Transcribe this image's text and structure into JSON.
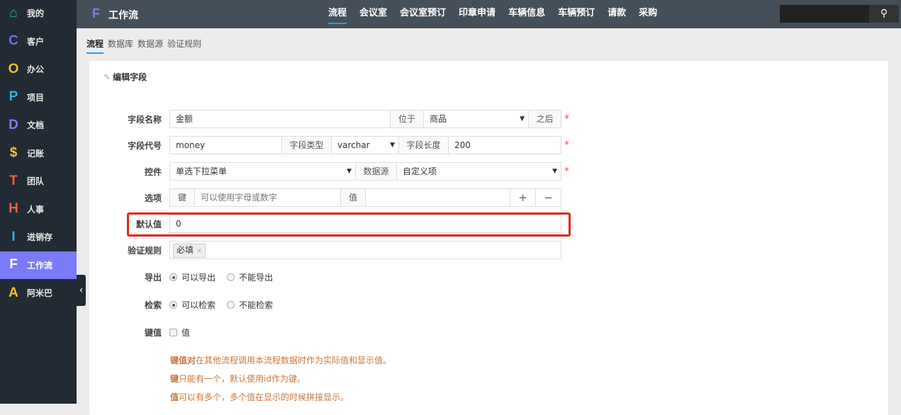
{
  "sidebar": {
    "items": [
      {
        "icon": "home-icon",
        "glyph": "⌂",
        "label": "我的",
        "color": "#29b6e0"
      },
      {
        "icon": "c-letter-icon",
        "glyph": "C",
        "label": "客户",
        "color": "#6b6ff0"
      },
      {
        "icon": "o-letter-icon",
        "glyph": "O",
        "label": "办公",
        "color": "#f2c037"
      },
      {
        "icon": "p-letter-icon",
        "glyph": "P",
        "label": "项目",
        "color": "#29b6e0"
      },
      {
        "icon": "d-letter-icon",
        "glyph": "D",
        "label": "文档",
        "color": "#7b7ff5"
      },
      {
        "icon": "dollar-icon",
        "glyph": "$",
        "label": "记账",
        "color": "#f2c037"
      },
      {
        "icon": "t-letter-icon",
        "glyph": "T",
        "label": "团队",
        "color": "#e8653a"
      },
      {
        "icon": "h-letter-icon",
        "glyph": "H",
        "label": "人事",
        "color": "#e8653a"
      },
      {
        "icon": "i-letter-icon",
        "glyph": "I",
        "label": "进销存",
        "color": "#29b6e0"
      },
      {
        "icon": "f-letter-icon",
        "glyph": "F",
        "label": "工作流",
        "color": "#ffffff"
      },
      {
        "icon": "a-letter-icon",
        "glyph": "A",
        "label": "阿米巴",
        "color": "#f2c037"
      }
    ],
    "active_index": 9
  },
  "header": {
    "logo": "F",
    "title": "工作流",
    "nav": [
      "流程",
      "会议室",
      "会议室预订",
      "印章申请",
      "车辆信息",
      "车辆预订",
      "请款",
      "采购"
    ]
  },
  "subtabs": [
    "流程",
    "数据库",
    "数据源",
    "验证规则"
  ],
  "card": {
    "title": "编辑字段"
  },
  "form": {
    "name_label": "字段名称",
    "name_value": "金额",
    "position_addon": "位于",
    "position_value": "商品",
    "after_addon": "之后",
    "code_label": "字段代号",
    "code_value": "money",
    "type_addon": "字段类型",
    "type_value": "varchar",
    "length_addon": "字段长度",
    "length_value": "200",
    "control_label": "控件",
    "control_value": "单选下拉菜单",
    "source_addon": "数据源",
    "source_value": "自定义项",
    "options_label": "选项",
    "key_addon": "键",
    "key_placeholder": "可以使用字母或数字",
    "value_addon": "值",
    "add": "+",
    "remove": "−",
    "default_label": "默认值",
    "default_value": "0",
    "rules_label": "验证规则",
    "rules_tag": "必填",
    "tag_remove": "×",
    "export_label": "导出",
    "export_yes": "可以导出",
    "export_no": "不能导出",
    "search_label": "检索",
    "search_yes": "可以检索",
    "search_no": "不能检索",
    "keyvalue_label": "键值",
    "keyvalue_option": "值",
    "required_mark": "*"
  },
  "notes": [
    {
      "bold": "键值对",
      "text": "在其他流程调用本流程数据时作为实际值和显示值。"
    },
    {
      "bold": "键",
      "text": "只能有一个，默认使用id作为键。"
    },
    {
      "bold": "值",
      "text": "可以有多个，多个值在显示的时候拼接显示。"
    }
  ]
}
